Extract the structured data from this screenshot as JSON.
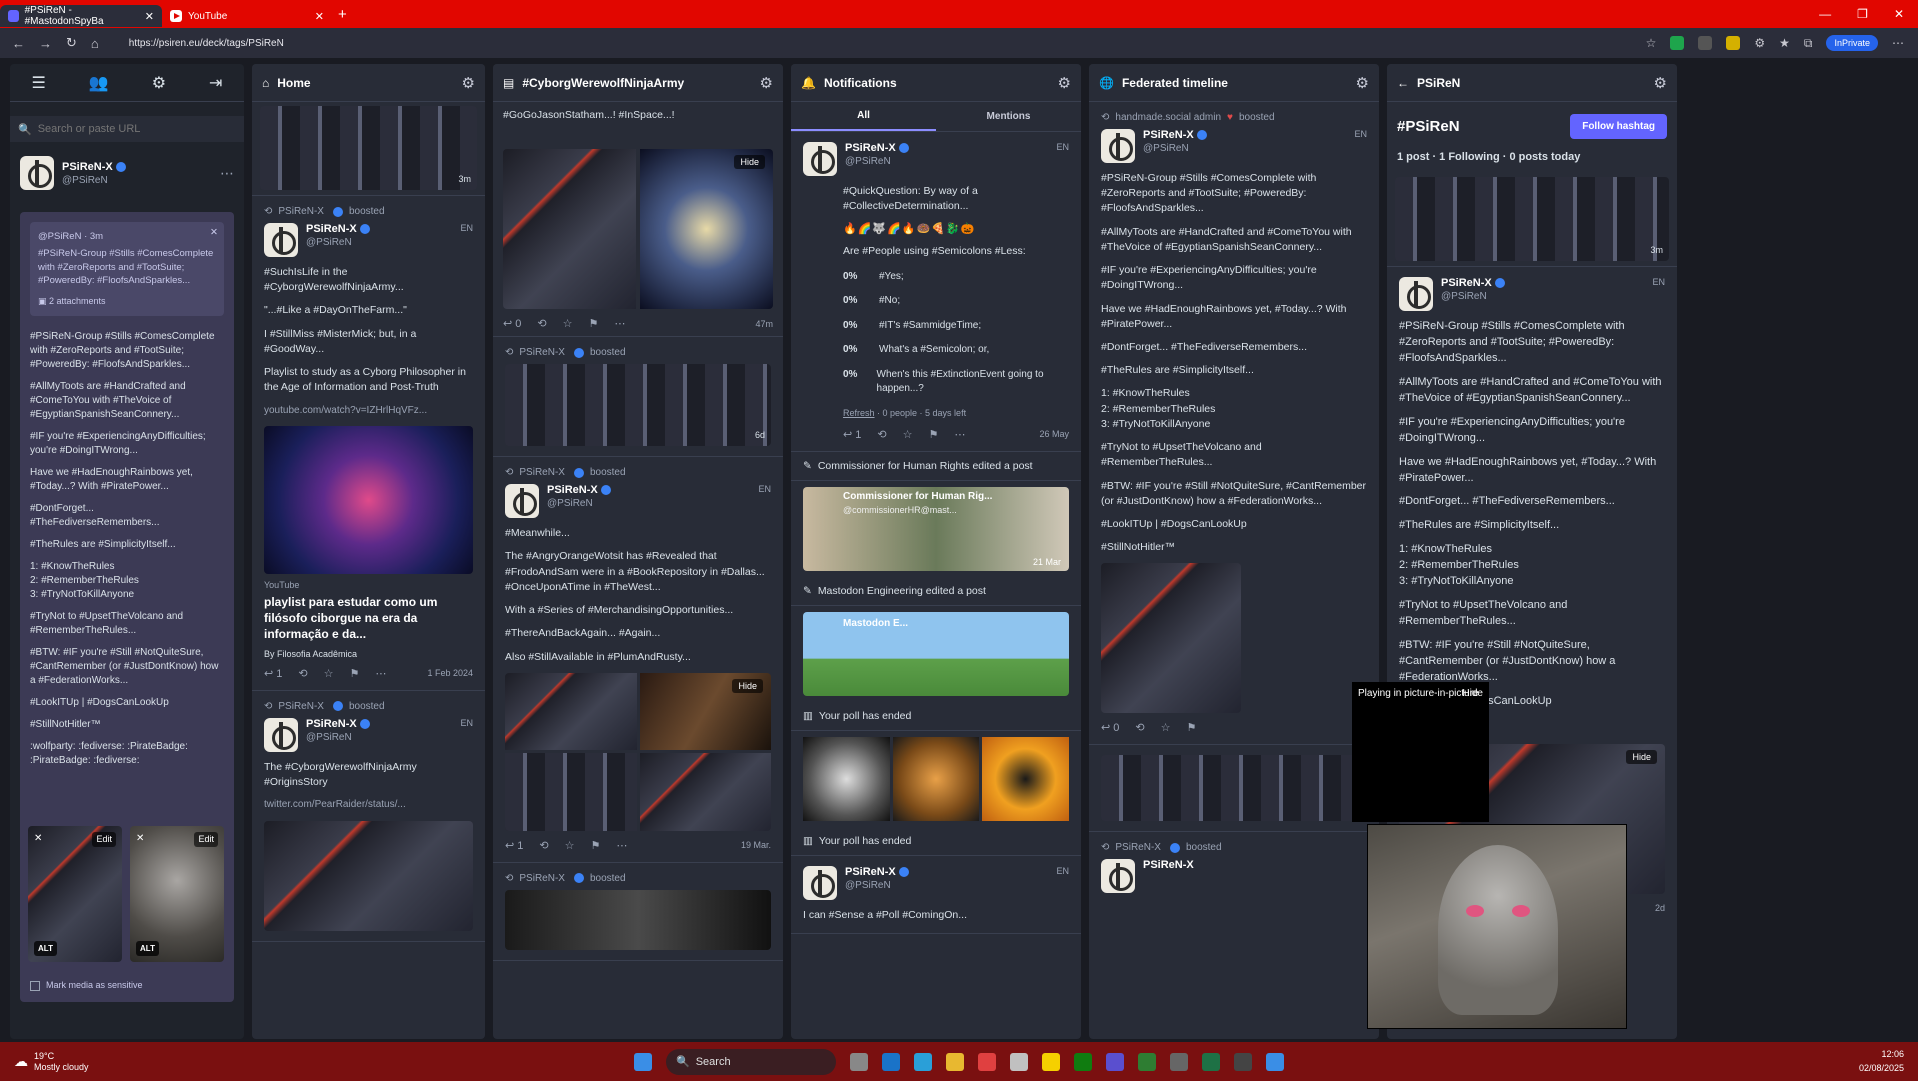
{
  "browser": {
    "tabs": [
      {
        "label": "#PSiReN - #MastodonSpyBa"
      },
      {
        "label": "YouTube"
      }
    ],
    "url": "https://psiren.eu/deck/tags/PSiReN",
    "inprivate": "InPrivate"
  },
  "sidebar": {
    "search_placeholder": "Search or paste URL",
    "profile": {
      "name": "PSiReN-X",
      "handle": "@PSiReN"
    },
    "reply_meta": "@PSiReN · 3m",
    "reply_text": "#PSiReN-Group #Stills #ComesComplete with #ZeroReports and #TootSuite; #PoweredBy: #FloofsAndSparkles...",
    "attachments": "2 attachments",
    "compose": [
      "#PSiReN-Group #Stills #ComesComplete with #ZeroReports and #TootSuite; #PoweredBy: #FloofsAndSparkles...",
      "#AllMyToots are #HandCrafted and #ComeToYou with #TheVoice of #EgyptianSpanishSeanConnery...",
      "#IF you're #ExperiencingAnyDifficulties; you're #DoingITWrong...",
      "Have we #HadEnoughRainbows yet, #Today...? With #PiratePower...",
      "#DontForget... #TheFediverseRemembers...",
      "#TheRules are #SimplicityItself...",
      "1: #KnowTheRules\n2: #RememberTheRules\n3: #TryNotToKillAnyone",
      "#TryNot to #UpsetTheVolcano and #RememberTheRules...",
      "#BTW: #IF you're #Still #NotQuiteSure, #CantRemember (or #JustDontKnow) how a #FederationWorks...",
      "#LookITUp | #DogsCanLookUp",
      "#StillNotHitler™",
      ":wolfparty: :fediverse: :PirateBadge: :PirateBadge: :fediverse:"
    ],
    "edit_label": "Edit",
    "alt_label": "ALT",
    "sensitive": "Mark media as sensitive"
  },
  "columns": {
    "home": {
      "title": "Home",
      "top_time": "3m",
      "boost1": {
        "boosted": "boosted",
        "name": "PSiReN-X",
        "handle": "@PSiReN",
        "lang": "EN",
        "lines": [
          "#SuchIsLife in the #CyborgWerewolfNinjaArmy...",
          "\"...#Like a #DayOnTheFarm...\"",
          "I #StillMiss #MisterMick; but, in a #GoodWay..."
        ],
        "desc": "Playlist to study as a Cyborg Philosopher in the Age of Information and Post-Truth",
        "link": "youtube.com/watch?v=IZHrlHqVFz...",
        "card_src": "YouTube",
        "card_title": "playlist para estudar como um filósofo ciborgue na era da informação e da...",
        "card_author": "By Filosofia Acadêmica",
        "replies": "1",
        "time": "1 Feb 2024"
      },
      "boost2": {
        "boosted": "boosted",
        "name": "PSiReN-X",
        "handle": "@PSiReN",
        "lang": "EN",
        "line": "The #CyborgWerewolfNinjaArmy #OriginsStory",
        "link": "twitter.com/PearRaider/status/..."
      }
    },
    "cyborg": {
      "title": "#CyborgWerewolfNinjaArmy",
      "top": "#GoGoJasonStatham...! #InSpace...!",
      "t1": "47m",
      "r1": "0",
      "b1": {
        "boosted": "boosted",
        "time": "6d",
        "r": "0"
      },
      "b2": {
        "boosted": "boosted",
        "name": "PSiReN-X",
        "handle": "@PSiReN",
        "lang": "EN",
        "lines": [
          "#Meanwhile...",
          "The #AngryOrangeWotsit has #Revealed that #FrodoAndSam were in a #BookRepository in #Dallas... #OnceUponATime in #TheWest...",
          "With a #Series of #MerchandisingOpportunities...",
          "#ThereAndBackAgain... #Again...",
          "Also #StillAvailable in #PlumAndRusty..."
        ],
        "time": "19 Mar.",
        "r": "1"
      },
      "b3": {
        "boosted": "boosted"
      }
    },
    "notifications": {
      "title": "Notifications",
      "tab_all": "All",
      "tab_mentions": "Mentions",
      "poll": {
        "name": "PSiReN-X",
        "handle": "@PSiReN",
        "lang": "EN",
        "q1": "#QuickQuestion: By way of a #CollectiveDetermination...",
        "q2": "Are #People using #Semicolons #Less:",
        "options": [
          {
            "pct": "0%",
            "label": "#Yes;"
          },
          {
            "pct": "0%",
            "label": "#No;"
          },
          {
            "pct": "0%",
            "label": "#IT's #SammidgeTime;"
          },
          {
            "pct": "0%",
            "label": "What's a #Semicolon; or,"
          },
          {
            "pct": "0%",
            "label": "When's this #ExtinctionEvent going to happen...?"
          }
        ],
        "refresh": "Refresh",
        "refresh_meta": " · 0 people · 5 days left",
        "time": "26 May",
        "r": "1"
      },
      "n1": "Commissioner for Human Rights edited a post",
      "n1_card": "Commissioner for Human Rig...",
      "n1_handle": "@commissionerHR@mast...",
      "n1_time": "21 Mar",
      "n2": "Mastodon Engineering edited a post",
      "n2_card": "Mastodon E...",
      "n3": "Your poll has ended",
      "n4": "Your poll has ended",
      "last": {
        "name": "PSiReN-X",
        "handle": "@PSiReN",
        "lang": "EN",
        "line": "I can #Sense a #Poll #ComingOn..."
      }
    },
    "federated": {
      "title": "Federated timeline",
      "boost_from": "handmade.social admin",
      "boosted": "boosted",
      "name": "PSiReN-X",
      "handle": "@PSiReN",
      "lang": "EN",
      "lines": [
        "#PSiReN-Group #Stills #ComesComplete with #ZeroReports and #TootSuite; #PoweredBy: #FloofsAndSparkles...",
        "#AllMyToots are #HandCrafted and #ComeToYou with #TheVoice of #EgyptianSpanishSeanConnery...",
        "#IF you're #ExperiencingAnyDifficulties; you're #DoingITWrong...",
        "Have we #HadEnoughRainbows yet, #Today...? With #PiratePower...",
        "#DontForget... #TheFediverseRemembers...",
        "#TheRules are #SimplicityItself...",
        "1: #KnowTheRules\n2: #RememberTheRules\n3: #TryNotToKillAnyone",
        "#TryNot to #UpsetTheVolcano and #RememberTheRules...",
        "#BTW: #IF you're #Still #NotQuiteSure, #CantRemember (or #JustDontKnow) how a #FederationWorks...",
        "#LookITUp | #DogsCanLookUp",
        "#StillNotHitler™"
      ],
      "pip": "Playing in picture-in-picture",
      "hide": "Hide",
      "r": "0",
      "boost2": "boosted",
      "name2": "PSiReN-X"
    },
    "psiren": {
      "title": "PSiReN",
      "hashtag": "#PSiReN",
      "follow": "Follow hashtag",
      "stats": "1 post · 1 Following · 0 posts today",
      "top_time": "3m",
      "name": "PSiReN-X",
      "handle": "@PSiReN",
      "lang": "EN",
      "lines": [
        "#PSiReN-Group #Stills #ComesComplete with #ZeroReports and #TootSuite; #PoweredBy: #FloofsAndSparkles...",
        "#AllMyToots are #HandCrafted and #ComeToYou with #TheVoice of #EgyptianSpanishSeanConnery...",
        "#IF you're #ExperiencingAnyDifficulties; you're #DoingITWrong...",
        "Have we #HadEnoughRainbows yet, #Today...? With #PiratePower...",
        "#DontForget... #TheFediverseRemembers...",
        "#TheRules are #SimplicityItself...",
        "1: #KnowTheRules\n2: #RememberTheRules\n3: #TryNotToKillAnyone",
        "#TryNot to #UpsetTheVolcano and #RememberTheRules...",
        "#BTW: #IF you're #Still #NotQuiteSure, #CantRemember (or #JustDontKnow) how a #FederationWorks...",
        "#LookITUp | #DogsCanLookUp",
        "#StillNotHitler™"
      ],
      "time": "2d"
    }
  },
  "taskbar": {
    "temp": "19°C",
    "weather": "Mostly cloudy",
    "search": "Search",
    "time": "12:06",
    "date": "02/08/2025"
  }
}
